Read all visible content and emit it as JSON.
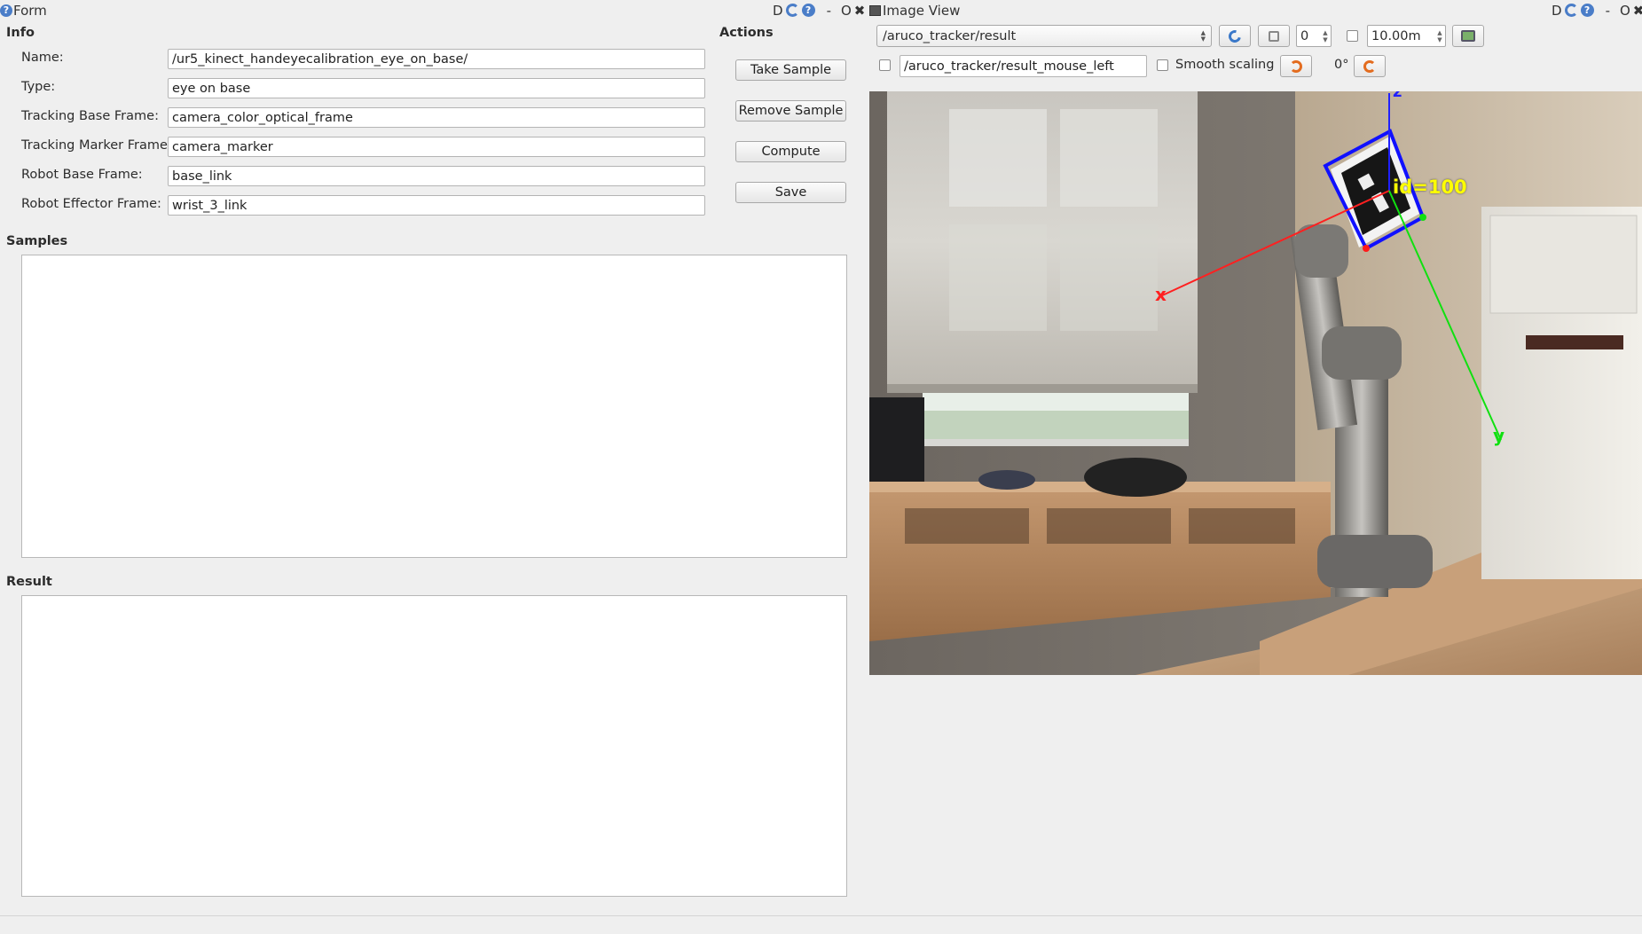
{
  "form_panel": {
    "title": "Form",
    "title_controls": {
      "d": "D",
      "minimize": "-",
      "restore": "O",
      "close": "✖"
    }
  },
  "info": {
    "heading": "Info",
    "rows": [
      {
        "label": "Name:",
        "value": "/ur5_kinect_handeyecalibration_eye_on_base/"
      },
      {
        "label": "Type:",
        "value": "eye on base"
      },
      {
        "label": "Tracking Base Frame:",
        "value": "camera_color_optical_frame"
      },
      {
        "label": "Tracking Marker Frame:",
        "value": "camera_marker"
      },
      {
        "label": "Robot Base Frame:",
        "value": "base_link"
      },
      {
        "label": "Robot Effector Frame:",
        "value": "wrist_3_link"
      }
    ]
  },
  "actions": {
    "heading": "Actions",
    "take_sample": "Take Sample",
    "remove_sample": "Remove Sample",
    "compute": "Compute",
    "save": "Save"
  },
  "samples": {
    "heading": "Samples"
  },
  "result": {
    "heading": "Result"
  },
  "image_view": {
    "title": "Image View",
    "title_controls": {
      "d": "D",
      "minimize": "-",
      "restore": "O",
      "close": "✖"
    },
    "topic": "/aruco_tracker/result",
    "num_value": "0",
    "max_range": "10.00m",
    "mouse_topic": "/aruco_tracker/result_mouse_left",
    "smooth_scaling": "Smooth scaling",
    "rotation": "0°"
  },
  "image_overlay": {
    "marker_label": "id=100",
    "axis_x": "x",
    "axis_y": "y",
    "axis_z": "z",
    "colors": {
      "marker": "#1010ff",
      "x_axis": "#ff2020",
      "y_axis": "#10e010",
      "z_axis": "#2020ff",
      "label": "#ffff00"
    }
  }
}
